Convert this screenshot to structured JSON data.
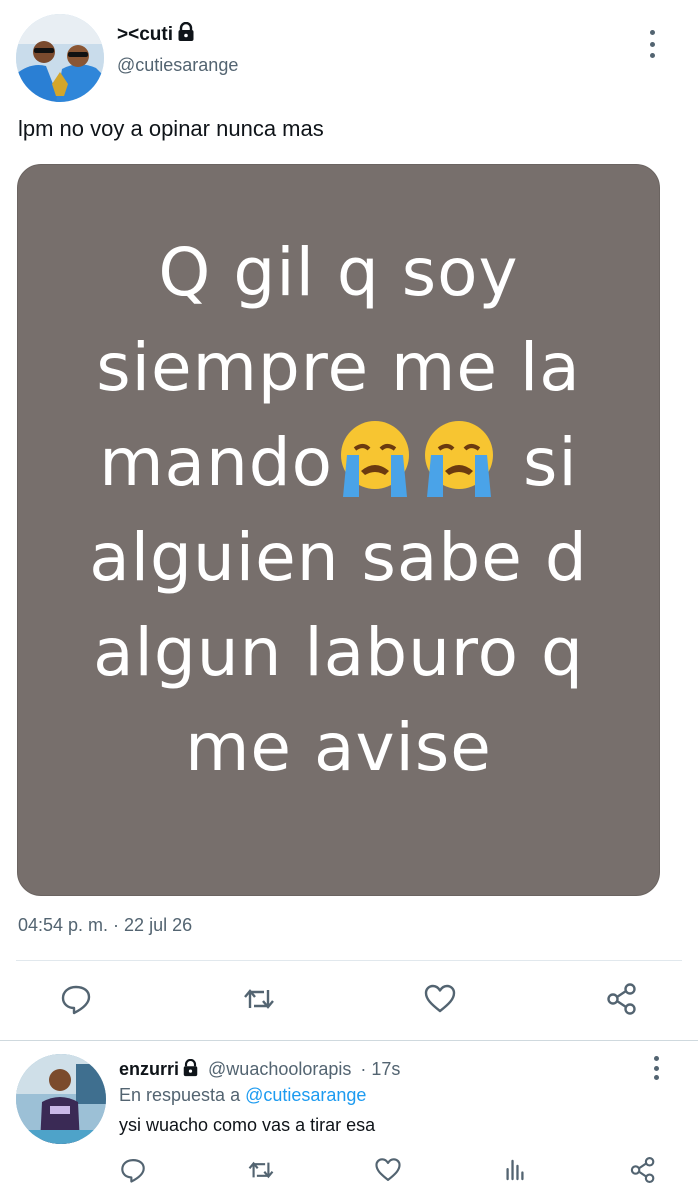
{
  "tweet": {
    "display_name": "><cuti",
    "handle": "@cutiesarange",
    "text": "lpm no voy a opinar nunca mas",
    "image_text_lines": [
      "Q gil q soy",
      "siempre me la",
      "mando",
      "si",
      "alguien sabe d",
      "algun laburo q",
      "me avise"
    ],
    "timestamp": "04:54 p. m. · 22 jul 26"
  },
  "icons": {
    "verified_lock": "lock-icon",
    "more": "more-vertical-icon",
    "reply": "reply-icon",
    "retweet": "retweet-icon",
    "like": "heart-icon",
    "share": "share-icon",
    "analytics": "analytics-icon",
    "emoji": "loudly-crying-face-emoji"
  },
  "reply": {
    "display_name": "enzurri",
    "handle": "@wuachoolorapis",
    "time": "· 17s",
    "in_reply_prefix": "En respuesta a",
    "in_reply_mention": "@cutiesarange",
    "text": "ysi wuacho como vas a tirar esa"
  },
  "colors": {
    "accent": "#1d9bf0",
    "secondary_text": "#536471",
    "media_bg": "#776f6c"
  }
}
